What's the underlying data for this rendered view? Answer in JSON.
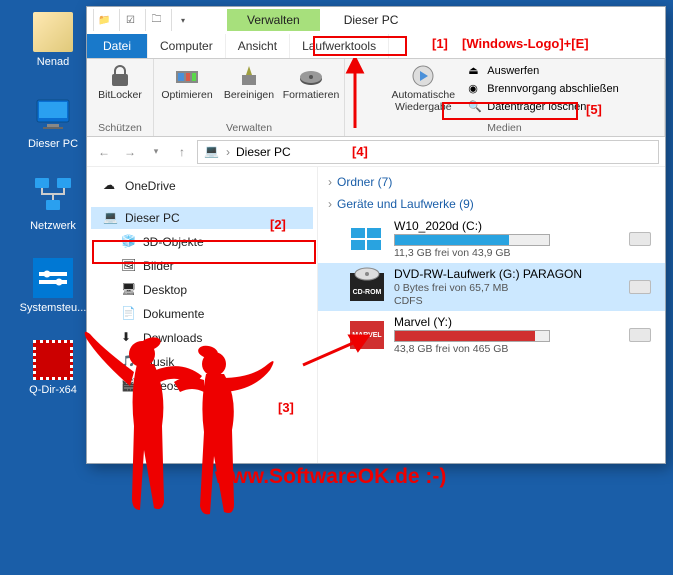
{
  "desktop": {
    "nenad": "Nenad",
    "pc": "Dieser PC",
    "network": "Netzwerk",
    "sys": "Systemsteu...",
    "qdir": "Q-Dir-x64"
  },
  "window": {
    "title": "Dieser PC",
    "verwalten_tab": "Verwalten",
    "tabs": {
      "datei": "Datei",
      "computer": "Computer",
      "ansicht": "Ansicht",
      "tools": "Laufwerktools"
    },
    "ribbon": {
      "bitlocker": "BitLocker",
      "schuetzen": "Schützen",
      "optimieren": "Optimieren",
      "bereinigen": "Bereinigen",
      "formatieren": "Formatieren",
      "verwalten": "Verwalten",
      "autowieder": "Automatische Wiedergabe",
      "auswerfen": "Auswerfen",
      "brenn": "Brennvorgang abschließen",
      "loeschen": "Datenträger löschen",
      "medien": "Medien"
    },
    "breadcrumb": "Dieser PC",
    "nav": {
      "onedrive": "OneDrive",
      "pc": "Dieser PC",
      "objects3d": "3D-Objekte",
      "bilder": "Bilder",
      "desktop": "Desktop",
      "dokumente": "Dokumente",
      "downloads": "Downloads",
      "musik": "Musik",
      "videos": "Videos"
    },
    "groups": {
      "ordner": "Ordner (7)",
      "geraete": "Geräte und Laufwerke (9)"
    },
    "drives": {
      "c": {
        "name": "W10_2020d (C:)",
        "sub": "11,3 GB frei von 43,9 GB",
        "fill": 74,
        "color": "#29a3e0"
      },
      "g": {
        "name": "DVD-RW-Laufwerk (G:) PARAGON",
        "sub": "0 Bytes frei von 65,7 MB",
        "sub2": "CDFS",
        "badge": "CD-ROM"
      },
      "y": {
        "name": "Marvel (Y:)",
        "sub": "43,8 GB frei von 465 GB",
        "fill": 91,
        "color": "#d03030",
        "badge": "MARVEL"
      }
    }
  },
  "annotations": {
    "label1": "[1]",
    "shortcut": "[Windows-Logo]+[E]",
    "label2": "[2]",
    "label3": "[3]",
    "label4": "[4]",
    "label5": "[5]",
    "watermark": "www.SoftwareOK.de :-)"
  }
}
